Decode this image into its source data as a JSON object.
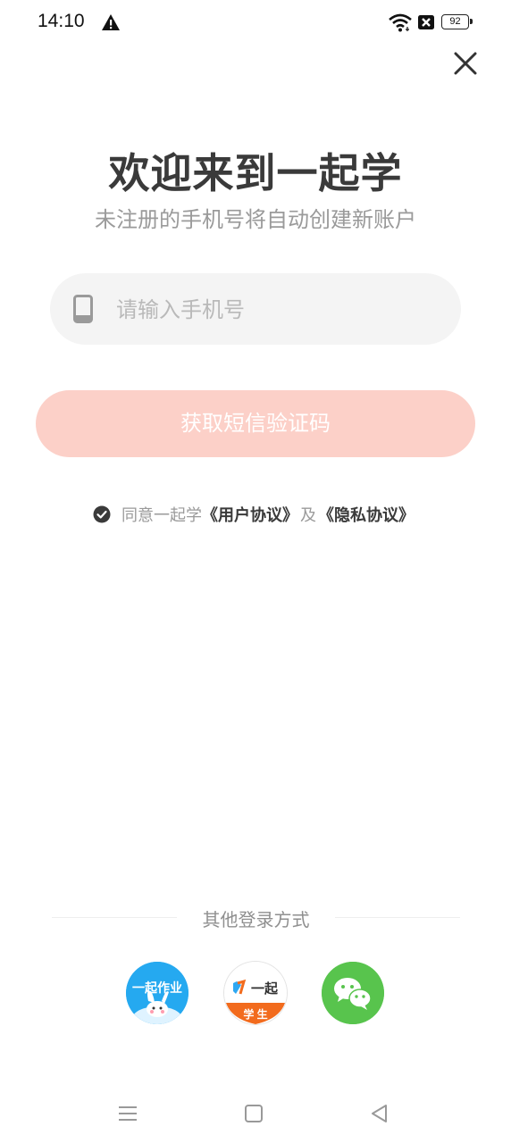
{
  "status_bar": {
    "time": "14:10",
    "battery": "92",
    "icons": [
      "alert-icon",
      "wifi-icon",
      "no-sim-icon",
      "battery-icon"
    ]
  },
  "header": {
    "close_icon": "close-icon"
  },
  "main": {
    "title": "欢迎来到一起学",
    "subtitle": "未注册的手机号将自动创建新账户",
    "phone_field": {
      "placeholder": "请输入手机号",
      "value": "",
      "icon": "phone-icon"
    },
    "sms_button_label": "获取短信验证码",
    "agreement": {
      "prefix": "同意一起学",
      "user_agreement": "《用户协议》",
      "joiner": "及",
      "privacy_policy": "《隐私协议》",
      "checked": true
    }
  },
  "other_login": {
    "label": "其他登录方式",
    "options": [
      {
        "name": "一起作业",
        "icon": "yiqi-zuoye-app-icon",
        "color": "#25a9f0"
      },
      {
        "name": "一起",
        "badge": "学 生",
        "icon": "yiqi-student-app-icon",
        "color": "#f26b1d"
      },
      {
        "name": "wechat",
        "icon": "wechat-icon",
        "color": "#58c44d"
      }
    ]
  },
  "nav_bar": {
    "icons": [
      "menu-icon",
      "home-square-icon",
      "back-triangle-icon"
    ]
  },
  "colors": {
    "primary_light": "#fcd0c8",
    "field_bg": "#f4f4f4",
    "title": "#3a3a3a",
    "muted": "#9a9a9a"
  }
}
